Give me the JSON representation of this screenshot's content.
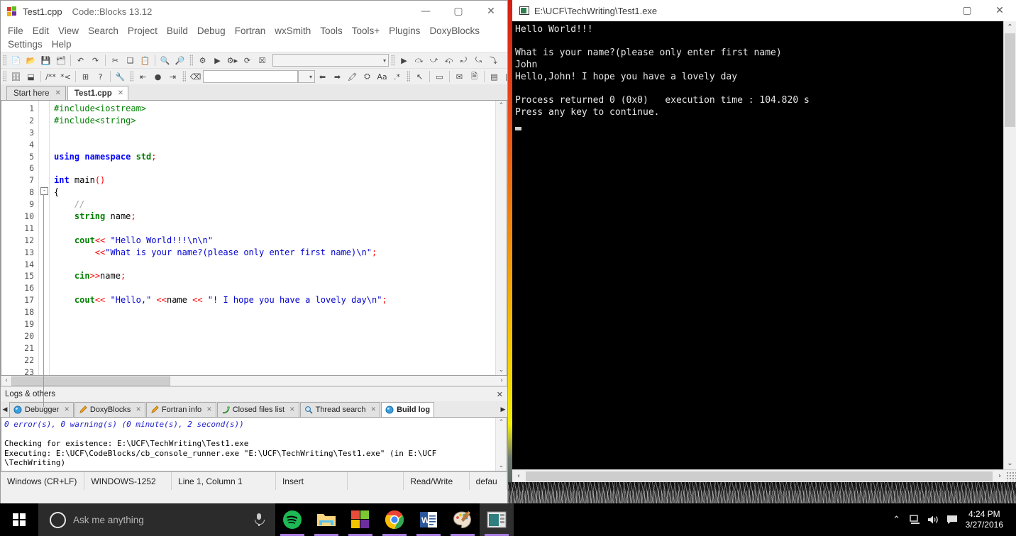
{
  "ide": {
    "title_file": "Test1.cpp",
    "title_app": "Code::Blocks 13.12",
    "window_buttons": {
      "minimize": "—",
      "maximize": "▢",
      "close": "✕"
    },
    "menu": [
      "File",
      "Edit",
      "View",
      "Search",
      "Project",
      "Build",
      "Debug",
      "Fortran",
      "wxSmith",
      "Tools",
      "Tools+",
      "Plugins",
      "DoxyBlocks",
      "Settings",
      "Help"
    ],
    "editor_tabs": [
      {
        "label": "Start here",
        "active": false,
        "close": "✕"
      },
      {
        "label": "Test1.cpp",
        "active": true,
        "close": "✕"
      }
    ],
    "code_lines": [
      {
        "n": 1,
        "tokens": [
          {
            "t": "#include<iostream>",
            "c": "pre"
          }
        ]
      },
      {
        "n": 2,
        "tokens": [
          {
            "t": "#include<string>",
            "c": "pre"
          }
        ]
      },
      {
        "n": 3,
        "tokens": []
      },
      {
        "n": 4,
        "tokens": []
      },
      {
        "n": 5,
        "tokens": [
          {
            "t": "using namespace ",
            "c": "k"
          },
          {
            "t": "std",
            "c": "t"
          },
          {
            "t": ";",
            "c": "op"
          }
        ]
      },
      {
        "n": 6,
        "tokens": []
      },
      {
        "n": 7,
        "tokens": [
          {
            "t": "int ",
            "c": "k"
          },
          {
            "t": "main",
            "c": "pl"
          },
          {
            "t": "()",
            "c": "op"
          }
        ]
      },
      {
        "n": 8,
        "tokens": [
          {
            "t": "{",
            "c": "pl"
          }
        ]
      },
      {
        "n": 9,
        "tokens": [
          {
            "t": "    //",
            "c": "cm"
          }
        ]
      },
      {
        "n": 10,
        "tokens": [
          {
            "t": "    ",
            "c": "pl"
          },
          {
            "t": "string",
            "c": "t"
          },
          {
            "t": " name",
            "c": "pl"
          },
          {
            "t": ";",
            "c": "op"
          }
        ]
      },
      {
        "n": 11,
        "tokens": []
      },
      {
        "n": 12,
        "tokens": [
          {
            "t": "    ",
            "c": "pl"
          },
          {
            "t": "cout",
            "c": "t"
          },
          {
            "t": "<<",
            "c": "op"
          },
          {
            "t": " \"Hello World!!!\\n\\n\"",
            "c": "s"
          }
        ]
      },
      {
        "n": 13,
        "tokens": [
          {
            "t": "        ",
            "c": "pl"
          },
          {
            "t": "<<",
            "c": "op"
          },
          {
            "t": "\"What is your name?(please only enter first name)\\n\"",
            "c": "s"
          },
          {
            "t": ";",
            "c": "op"
          }
        ]
      },
      {
        "n": 14,
        "tokens": []
      },
      {
        "n": 15,
        "tokens": [
          {
            "t": "    ",
            "c": "pl"
          },
          {
            "t": "cin",
            "c": "t"
          },
          {
            "t": ">>",
            "c": "op"
          },
          {
            "t": "name",
            "c": "pl"
          },
          {
            "t": ";",
            "c": "op"
          }
        ]
      },
      {
        "n": 16,
        "tokens": []
      },
      {
        "n": 17,
        "tokens": [
          {
            "t": "    ",
            "c": "pl"
          },
          {
            "t": "cout",
            "c": "t"
          },
          {
            "t": "<<",
            "c": "op"
          },
          {
            "t": " \"Hello,\"",
            "c": "s"
          },
          {
            "t": " ",
            "c": "pl"
          },
          {
            "t": "<<",
            "c": "op"
          },
          {
            "t": "name",
            "c": "pl"
          },
          {
            "t": " ",
            "c": "pl"
          },
          {
            "t": "<<",
            "c": "op"
          },
          {
            "t": " \"! I hope you have a lovely day\\n\"",
            "c": "s"
          },
          {
            "t": ";",
            "c": "op"
          }
        ]
      },
      {
        "n": 18,
        "tokens": []
      },
      {
        "n": 19,
        "tokens": []
      },
      {
        "n": 20,
        "tokens": []
      },
      {
        "n": 21,
        "tokens": []
      },
      {
        "n": 22,
        "tokens": []
      },
      {
        "n": 23,
        "tokens": []
      }
    ],
    "fold_marker": "-",
    "logs": {
      "panel_title": "Logs & others",
      "panel_close": "✕",
      "scroll_left": "◀",
      "scroll_right": "▶",
      "tabs": [
        {
          "label": "Debugger",
          "active": false,
          "close": "✕",
          "icon": "debugger-icon"
        },
        {
          "label": "DoxyBlocks",
          "active": false,
          "close": "✕",
          "icon": "pencil-icon"
        },
        {
          "label": "Fortran info",
          "active": false,
          "close": "✕",
          "icon": "pencil-icon"
        },
        {
          "label": "Closed files list",
          "active": false,
          "close": "✕",
          "icon": "plug-icon"
        },
        {
          "label": "Thread search",
          "active": false,
          "close": "✕",
          "icon": "magnifier-icon"
        },
        {
          "label": "Build log",
          "active": true,
          "close": "",
          "icon": "build-icon"
        }
      ],
      "build_output_head": "0 error(s), 0 warning(s) (0 minute(s), 2 second(s))",
      "build_output_body": "Checking for existence: E:\\UCF\\TechWriting\\Test1.exe\nExecuting: E:\\UCF\\CodeBlocks/cb_console_runner.exe \"E:\\UCF\\TechWriting\\Test1.exe\" (in E:\\UCF\n\\TechWriting)"
    },
    "statusbar": [
      "Windows (CR+LF)",
      "WINDOWS-1252",
      "Line 1, Column 1",
      "Insert",
      "",
      "Read/Write",
      "defau"
    ]
  },
  "console": {
    "title": "E:\\UCF\\TechWriting\\Test1.exe",
    "window_buttons": {
      "maximize": "▢",
      "close": "✕"
    },
    "output": "Hello World!!!\n\nWhat is your name?(please only enter first name)\nJohn\nHello,John! I hope you have a lovely day\n\nProcess returned 0 (0x0)   execution time : 104.820 s\nPress any key to continue.\n",
    "scroll_up": "⌃",
    "scroll_down": "⌄",
    "scroll_left": "‹",
    "scroll_right": "›"
  },
  "taskbar": {
    "search_placeholder": "Ask me anything",
    "apps": [
      {
        "name": "spotify",
        "active": false
      },
      {
        "name": "file-explorer",
        "active": false
      },
      {
        "name": "microsoft-store",
        "active": false
      },
      {
        "name": "google-chrome",
        "active": false
      },
      {
        "name": "microsoft-word",
        "active": false
      },
      {
        "name": "paint",
        "active": false
      },
      {
        "name": "code-blocks",
        "active": true
      }
    ],
    "tray": [
      "⌃",
      "network-icon",
      "volume-icon",
      "action-center-icon"
    ],
    "time": "4:24 PM",
    "date": "3/27/2016"
  }
}
